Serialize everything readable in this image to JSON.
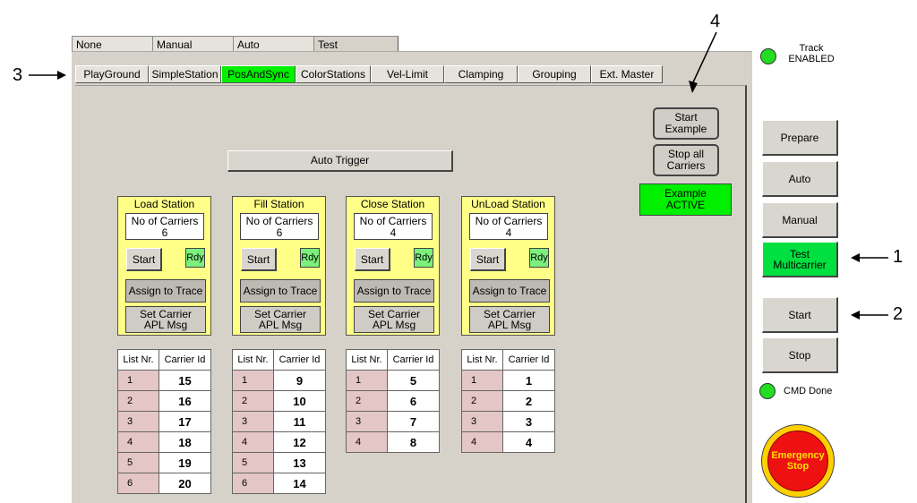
{
  "mode_tabs": [
    "None",
    "Manual",
    "Auto",
    "Test"
  ],
  "sub_tabs": [
    "PlayGround",
    "SimpleStation",
    "PosAndSync",
    "ColorStations",
    "Vel-Limit",
    "Clamping",
    "Grouping",
    "Ext. Master"
  ],
  "active_sub_tab": "PosAndSync",
  "callouts": {
    "one": "1",
    "two": "2",
    "three": "3",
    "four": "4"
  },
  "auto_trigger": "Auto Trigger",
  "start_example": "Start\nExample",
  "stop_all_carriers": "Stop all\nCarriers",
  "example_active": "Example\nACTIVE",
  "stations": [
    {
      "title": "Load Station",
      "count_label": "No of Carriers",
      "count": "6",
      "start": "Start",
      "rdy": "Rdy",
      "assign": "Assign to Trace",
      "set_carrier": "Set Carrier\nAPL Msg"
    },
    {
      "title": "Fill Station",
      "count_label": "No of Carriers",
      "count": "6",
      "start": "Start",
      "rdy": "Rdy",
      "assign": "Assign to Trace",
      "set_carrier": "Set Carrier\nAPL Msg"
    },
    {
      "title": "Close Station",
      "count_label": "No of Carriers",
      "count": "4",
      "start": "Start",
      "rdy": "Rdy",
      "assign": "Assign to Trace",
      "set_carrier": "Set Carrier\nAPL Msg"
    },
    {
      "title": "UnLoad Station",
      "count_label": "No of Carriers",
      "count": "4",
      "start": "Start",
      "rdy": "Rdy",
      "assign": "Assign to Trace",
      "set_carrier": "Set Carrier\nAPL Msg"
    }
  ],
  "table_headers": {
    "list_nr": "List Nr.",
    "carrier_id": "Carrier Id"
  },
  "tables": [
    [
      [
        "1",
        "15"
      ],
      [
        "2",
        "16"
      ],
      [
        "3",
        "17"
      ],
      [
        "4",
        "18"
      ],
      [
        "5",
        "19"
      ],
      [
        "6",
        "20"
      ]
    ],
    [
      [
        "1",
        "9"
      ],
      [
        "2",
        "10"
      ],
      [
        "3",
        "11"
      ],
      [
        "4",
        "12"
      ],
      [
        "5",
        "13"
      ],
      [
        "6",
        "14"
      ]
    ],
    [
      [
        "1",
        "5"
      ],
      [
        "2",
        "6"
      ],
      [
        "3",
        "7"
      ],
      [
        "4",
        "8"
      ]
    ],
    [
      [
        "1",
        "1"
      ],
      [
        "2",
        "2"
      ],
      [
        "3",
        "3"
      ],
      [
        "4",
        "4"
      ]
    ]
  ],
  "track_status": "Track\nENABLED",
  "side_buttons": [
    "Prepare",
    "Auto",
    "Manual",
    "Test\nMulticarrier",
    "Start",
    "Stop"
  ],
  "cmd_done": "CMD Done",
  "emergency_stop": "Emergency\nStop",
  "colors": {
    "active_green": "#00f000",
    "station_yellow": "#ffff88",
    "panel_gray": "#d6d2ca",
    "emergency_red": "#ee1111",
    "emergency_ring": "#ffd000"
  }
}
